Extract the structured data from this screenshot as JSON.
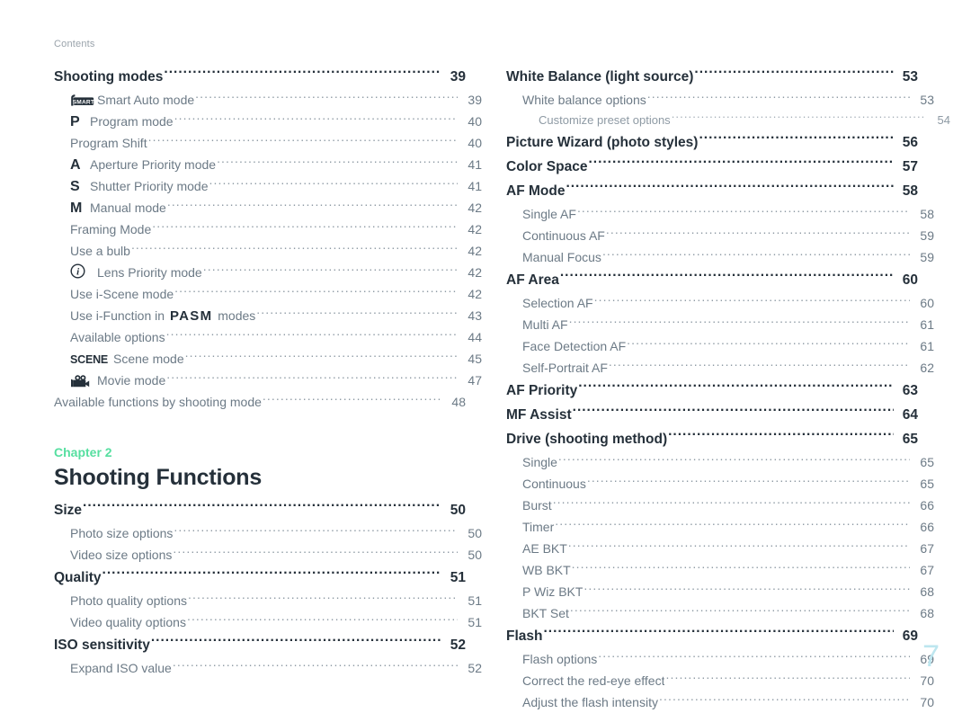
{
  "running_head": "Contents",
  "folio": "7",
  "colors": {
    "heading": "#25303a",
    "subentry": "#6c7a86",
    "subsub": "#8e9aa4",
    "chapter_accent": "#56dfa0",
    "folio": "#bde6ef"
  },
  "chapter": {
    "kicker": "Chapter 2",
    "title": "Shooting Functions"
  },
  "left_column": [
    {
      "level": 1,
      "icon": "",
      "label": "Shooting modes",
      "page": "39"
    },
    {
      "level": 2,
      "icon": "smart-icon",
      "label": "Smart Auto mode",
      "page": "39"
    },
    {
      "level": 2,
      "icon": "mode-p",
      "label": "Program mode",
      "page": "40"
    },
    {
      "level": 2,
      "icon": "",
      "label": "Program Shift",
      "page": "40"
    },
    {
      "level": 2,
      "icon": "mode-a",
      "label": "Aperture Priority mode",
      "page": "41"
    },
    {
      "level": 2,
      "icon": "mode-s",
      "label": "Shutter Priority mode",
      "page": "41"
    },
    {
      "level": 2,
      "icon": "mode-m",
      "label": "Manual mode",
      "page": "42"
    },
    {
      "level": 2,
      "icon": "",
      "label": "Framing Mode",
      "page": "42"
    },
    {
      "level": 2,
      "icon": "",
      "label": "Use a bulb",
      "page": "42"
    },
    {
      "level": 2,
      "icon": "lens-i-icon",
      "label": "Lens Priority mode",
      "page": "42"
    },
    {
      "level": 2,
      "icon": "",
      "label": "Use i-Scene mode",
      "page": "42"
    },
    {
      "level": 2,
      "icon": "",
      "label": "Use i-Function in PASM modes",
      "page": "43",
      "rich": {
        "pre": "Use i-Function in ",
        "emph": "PASM",
        "post": " modes"
      }
    },
    {
      "level": 2,
      "icon": "",
      "label": "Available options",
      "page": "44"
    },
    {
      "level": 2,
      "icon": "scene-icon",
      "label": "Scene mode",
      "page": "45"
    },
    {
      "level": 2,
      "icon": "movie-icon",
      "label": "Movie mode",
      "page": "47"
    },
    {
      "level": 2,
      "icon": "",
      "label": "Available functions by shooting mode",
      "page": "48",
      "flush": true
    }
  ],
  "left_column_after_chapter": [
    {
      "level": 1,
      "icon": "",
      "label": "Size",
      "page": "50"
    },
    {
      "level": 2,
      "icon": "",
      "label": "Photo size options",
      "page": "50"
    },
    {
      "level": 2,
      "icon": "",
      "label": "Video size options",
      "page": "50"
    },
    {
      "level": 1,
      "icon": "",
      "label": "Quality",
      "page": "51"
    },
    {
      "level": 2,
      "icon": "",
      "label": "Photo quality options",
      "page": "51"
    },
    {
      "level": 2,
      "icon": "",
      "label": "Video quality options",
      "page": "51"
    },
    {
      "level": 1,
      "icon": "",
      "label": "ISO sensitivity",
      "page": "52"
    },
    {
      "level": 2,
      "icon": "",
      "label": "Expand ISO value",
      "page": "52"
    }
  ],
  "right_column": [
    {
      "level": 1,
      "icon": "",
      "label": "White Balance (light source)",
      "page": "53"
    },
    {
      "level": 2,
      "icon": "",
      "label": "White balance options",
      "page": "53"
    },
    {
      "level": 3,
      "icon": "",
      "label": "Customize preset options",
      "page": "54"
    },
    {
      "level": 1,
      "icon": "",
      "label": "Picture Wizard (photo styles)",
      "page": "56"
    },
    {
      "level": 1,
      "icon": "",
      "label": "Color Space",
      "page": "57"
    },
    {
      "level": 1,
      "icon": "",
      "label": "AF Mode",
      "page": "58"
    },
    {
      "level": 2,
      "icon": "",
      "label": "Single AF",
      "page": "58"
    },
    {
      "level": 2,
      "icon": "",
      "label": "Continuous AF",
      "page": "59"
    },
    {
      "level": 2,
      "icon": "",
      "label": "Manual Focus",
      "page": "59"
    },
    {
      "level": 1,
      "icon": "",
      "label": "AF Area",
      "page": "60"
    },
    {
      "level": 2,
      "icon": "",
      "label": "Selection AF",
      "page": "60"
    },
    {
      "level": 2,
      "icon": "",
      "label": "Multi AF",
      "page": "61"
    },
    {
      "level": 2,
      "icon": "",
      "label": "Face Detection AF",
      "page": "61"
    },
    {
      "level": 2,
      "icon": "",
      "label": "Self-Portrait AF",
      "page": "62"
    },
    {
      "level": 1,
      "icon": "",
      "label": "AF Priority",
      "page": "63"
    },
    {
      "level": 1,
      "icon": "",
      "label": "MF Assist",
      "page": "64"
    },
    {
      "level": 1,
      "icon": "",
      "label": "Drive (shooting method)",
      "page": "65"
    },
    {
      "level": 2,
      "icon": "",
      "label": "Single",
      "page": "65"
    },
    {
      "level": 2,
      "icon": "",
      "label": "Continuous",
      "page": "65"
    },
    {
      "level": 2,
      "icon": "",
      "label": "Burst",
      "page": "66"
    },
    {
      "level": 2,
      "icon": "",
      "label": "Timer",
      "page": "66"
    },
    {
      "level": 2,
      "icon": "",
      "label": "AE BKT",
      "page": "67"
    },
    {
      "level": 2,
      "icon": "",
      "label": "WB BKT",
      "page": "67"
    },
    {
      "level": 2,
      "icon": "",
      "label": "P Wiz BKT",
      "page": "68"
    },
    {
      "level": 2,
      "icon": "",
      "label": "BKT Set",
      "page": "68"
    },
    {
      "level": 1,
      "icon": "",
      "label": "Flash",
      "page": "69"
    },
    {
      "level": 2,
      "icon": "",
      "label": "Flash options",
      "page": "69"
    },
    {
      "level": 2,
      "icon": "",
      "label": "Correct the red-eye effect",
      "page": "70"
    },
    {
      "level": 2,
      "icon": "",
      "label": "Adjust the flash intensity",
      "page": "70"
    }
  ],
  "icon_glyphs": {
    "smart-icon": "SMART",
    "mode-p": "P",
    "mode-a": "A",
    "mode-s": "S",
    "mode-m": "M",
    "lens-i-icon": "i",
    "scene-icon": "SCENE",
    "movie-icon": "movie-camera"
  }
}
